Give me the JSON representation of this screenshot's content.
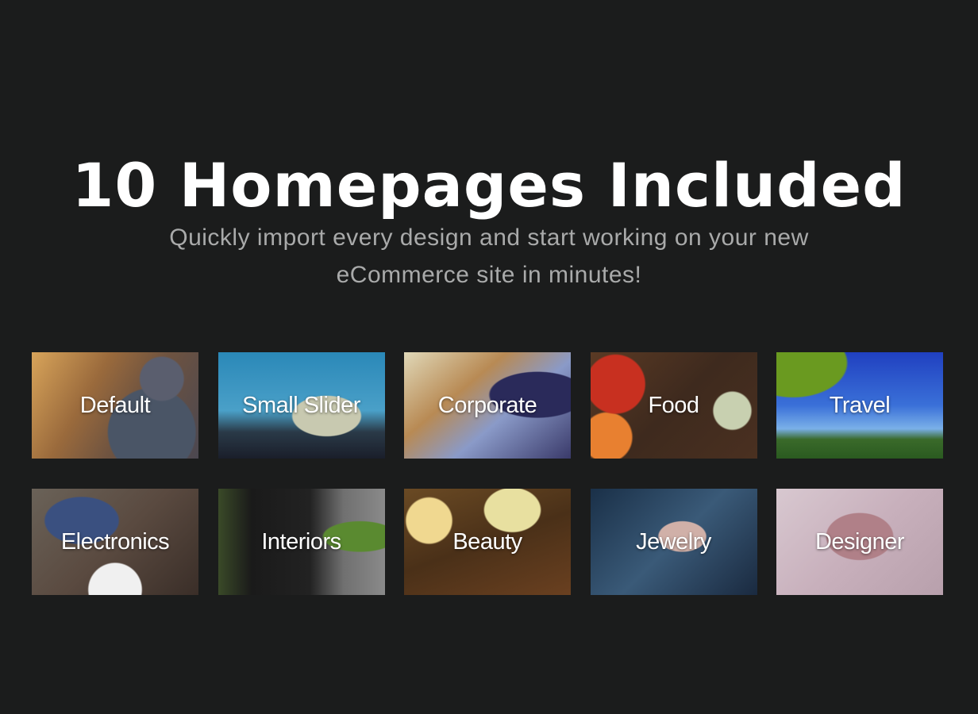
{
  "header": {
    "title": "10 Homepages Included",
    "subtitle_line1": "Quickly import every design and start working on your new",
    "subtitle_line2": "eCommerce site in minutes!"
  },
  "homepages": [
    {
      "label": "Default",
      "theme": "default"
    },
    {
      "label": "Small Slider",
      "theme": "slider"
    },
    {
      "label": "Corporate",
      "theme": "corporate"
    },
    {
      "label": "Food",
      "theme": "food"
    },
    {
      "label": "Travel",
      "theme": "travel"
    },
    {
      "label": "Electronics",
      "theme": "electronics"
    },
    {
      "label": "Interiors",
      "theme": "interiors"
    },
    {
      "label": "Beauty",
      "theme": "beauty"
    },
    {
      "label": "Jewelry",
      "theme": "jewelry"
    },
    {
      "label": "Designer",
      "theme": "designer"
    }
  ],
  "colors": {
    "background": "#1b1c1c",
    "title": "#ffffff",
    "subtitle": "#a9aaaa"
  }
}
